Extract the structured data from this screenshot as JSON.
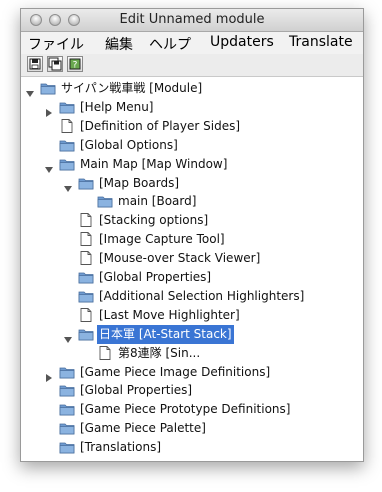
{
  "window": {
    "title": "Edit Unnamed module"
  },
  "menubar": {
    "items": [
      "ファイル",
      "編集",
      "ヘルプ",
      "Updaters",
      "Translate"
    ]
  },
  "toolbar": {
    "buttons": [
      "save-icon",
      "save-as-icon",
      "check-icon"
    ]
  },
  "tree": {
    "nodes": [
      {
        "label": "サイパン戦車戦 [Module]",
        "type": "folder",
        "state": "expanded"
      },
      {
        "label": "[Help Menu]",
        "type": "folder",
        "state": "collapsed"
      },
      {
        "label": "[Definition of Player Sides]",
        "type": "file"
      },
      {
        "label": "[Global Options]",
        "type": "folder"
      },
      {
        "label": "Main Map [Map Window]",
        "type": "folder",
        "state": "expanded"
      },
      {
        "label": "[Map Boards]",
        "type": "folder",
        "state": "expanded"
      },
      {
        "label": "main [Board]",
        "type": "folder"
      },
      {
        "label": "[Stacking options]",
        "type": "file"
      },
      {
        "label": "[Image Capture Tool]",
        "type": "file"
      },
      {
        "label": "[Mouse-over Stack Viewer]",
        "type": "file"
      },
      {
        "label": "[Global Properties]",
        "type": "folder"
      },
      {
        "label": "[Additional Selection Highlighters]",
        "type": "folder"
      },
      {
        "label": "[Last Move Highlighter]",
        "type": "file"
      },
      {
        "label": "日本軍 [At-Start Stack]",
        "type": "folder",
        "state": "expanded",
        "selected": true
      },
      {
        "label": "第8連隊 [Sin...",
        "type": "file"
      },
      {
        "label": "[Game Piece Image Definitions]",
        "type": "folder",
        "state": "collapsed"
      },
      {
        "label": "[Global Properties]",
        "type": "folder"
      },
      {
        "label": "[Game Piece Prototype Definitions]",
        "type": "folder"
      },
      {
        "label": "[Game Piece Palette]",
        "type": "folder"
      },
      {
        "label": "[Translations]",
        "type": "folder"
      }
    ]
  },
  "colors": {
    "selection": "#3a75d4",
    "folder": "#6f9bd0"
  }
}
